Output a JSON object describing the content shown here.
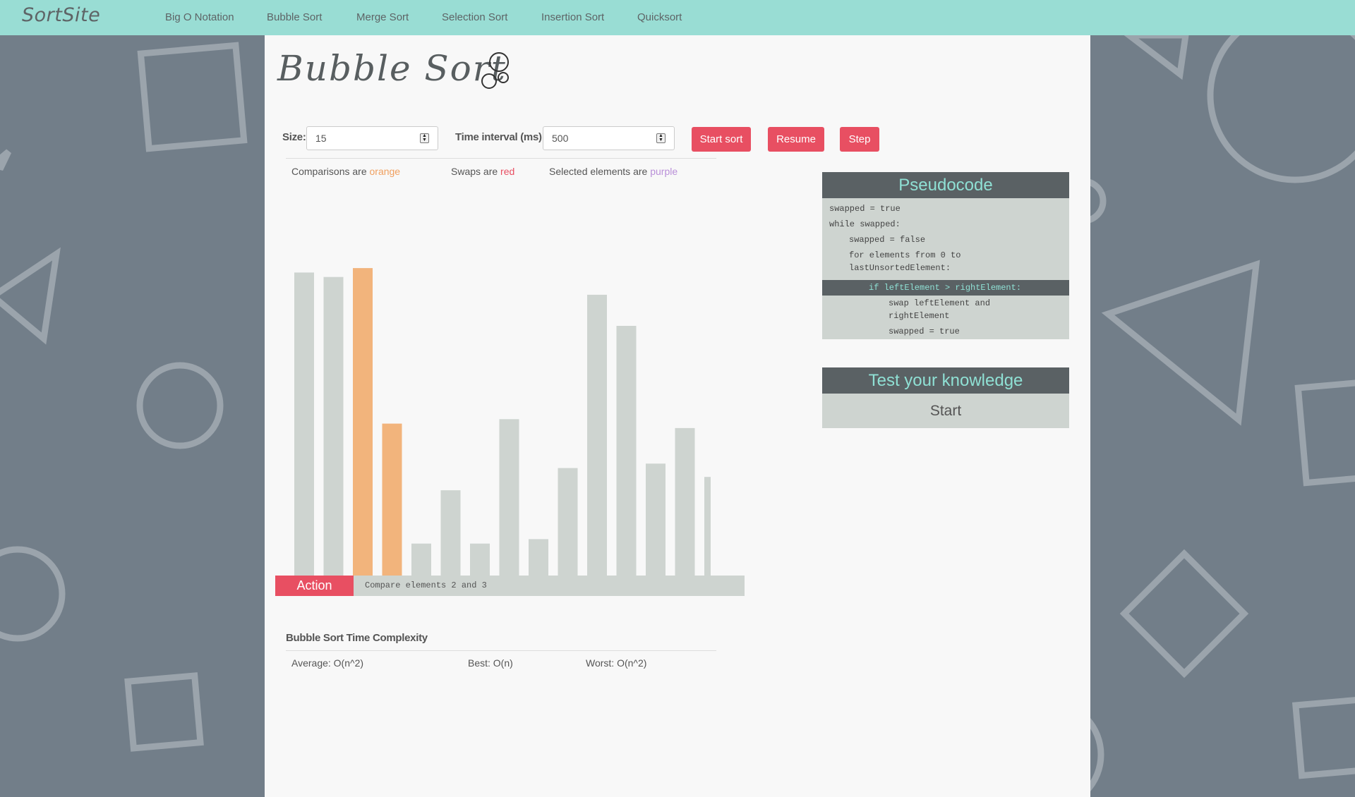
{
  "nav": {
    "brand": "SortSite",
    "links": [
      "Big O Notation",
      "Bubble Sort",
      "Merge Sort",
      "Selection Sort",
      "Insertion Sort",
      "Quicksort"
    ]
  },
  "page": {
    "title": "Bubble Sort",
    "icon": "bubbles-icon"
  },
  "controls": {
    "size_label": "Size:",
    "size_value": "15",
    "interval_label": "Time interval (ms):",
    "interval_value": "500",
    "start_label": "Start sort",
    "resume_label": "Resume",
    "step_label": "Step"
  },
  "legend": {
    "comparisons_prefix": "Comparisons are",
    "comparisons_word": "orange",
    "swaps_prefix": "Swaps are",
    "swaps_word": "red",
    "selected_prefix": "Selected elements are",
    "selected_word": "purple"
  },
  "chart_data": {
    "type": "bar",
    "values": [
      72,
      71,
      73,
      38,
      11,
      23,
      11,
      39,
      12,
      28,
      67,
      60,
      29,
      37,
      26
    ],
    "highlighted": [
      2,
      3
    ],
    "ylim": [
      0,
      75
    ],
    "colors": {
      "default": "#ced4d0",
      "comparison": "#f2b47c"
    }
  },
  "action": {
    "label": "Action",
    "text": "Compare elements 2 and 3"
  },
  "complexity": {
    "title": "Bubble Sort Time Complexity",
    "average": "Average: O(n^2)",
    "best": "Best: O(n)",
    "worst": "Worst: O(n^2)"
  },
  "pseudocode": {
    "title": "Pseudocode",
    "lines": [
      "swapped = true",
      "while swapped:",
      "swapped = false",
      "for elements from 0 to",
      "lastUnsortedElement:",
      "if leftElement > rightElement:",
      "swap leftElement and",
      "rightElement",
      "swapped = true"
    ]
  },
  "quiz": {
    "title": "Test your knowledge",
    "start_label": "Start"
  },
  "colors": {
    "accent": "#e84f62",
    "nav": "#99ddd4",
    "background": "#727e89",
    "panel_dark": "#5a6164",
    "panel_text": "#8fe0d4"
  }
}
